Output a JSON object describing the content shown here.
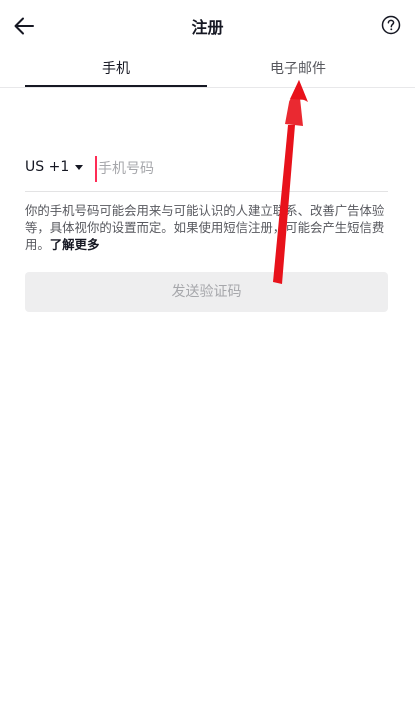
{
  "header": {
    "title": "注册",
    "back_icon": "arrow-left-icon",
    "help_icon": "question-circle-icon"
  },
  "tabs": [
    {
      "label": "手机",
      "active": true
    },
    {
      "label": "电子邮件",
      "active": false
    }
  ],
  "phone": {
    "country_code": "US +1",
    "placeholder": "手机号码",
    "value": ""
  },
  "notice": {
    "text": "你的手机号码可能会用来与可能认识的人建立联系、改善广告体验等，具体视你的设置而定。如果使用短信注册，可能会产生短信费用。",
    "link_label": "了解更多"
  },
  "send_button": {
    "label": "发送验证码",
    "enabled": false
  },
  "colors": {
    "accent": "#fe2c55",
    "annotation_arrow": "#e8121b",
    "text_primary": "#161823",
    "text_secondary": "#57585e",
    "disabled_bg": "#eeeeef",
    "disabled_text": "#a6a7ab"
  }
}
